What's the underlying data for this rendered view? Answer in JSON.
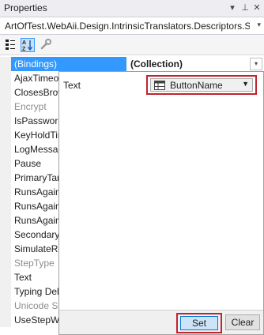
{
  "window": {
    "title": "Properties",
    "pin_glyph": "▾",
    "autohide_glyph": "⊥",
    "close_glyph": "✕"
  },
  "object_selector": {
    "value": "ArtOfTest.WebAii.Design.IntrinsicTranslators.Descriptors.Se",
    "arrow": "▾"
  },
  "toolbar": {
    "tools": [
      {
        "name": "categorized-icon",
        "active": false
      },
      {
        "name": "alphabetical-icon",
        "active": true
      },
      {
        "name": "wrench-icon",
        "active": false
      }
    ]
  },
  "grid": {
    "selected": {
      "name": "(Bindings)",
      "value": "(Collection)",
      "dropdown": "▾"
    },
    "rows": [
      {
        "name": "AjaxTimeout",
        "disabled": false
      },
      {
        "name": "ClosesBrowser",
        "disabled": false
      },
      {
        "name": "Encrypt",
        "disabled": true
      },
      {
        "name": "IsPassword",
        "disabled": false
      },
      {
        "name": "KeyHoldTime",
        "disabled": false
      },
      {
        "name": "LogMessage",
        "disabled": false
      },
      {
        "name": "Pause",
        "disabled": false
      },
      {
        "name": "PrimaryTarget",
        "disabled": false
      },
      {
        "name": "RunsAgainst",
        "disabled": false
      },
      {
        "name": "RunsAgainst",
        "disabled": false
      },
      {
        "name": "RunsAgainst",
        "disabled": false
      },
      {
        "name": "SecondaryTarget",
        "disabled": false
      },
      {
        "name": "SimulateRealTyping",
        "disabled": false
      },
      {
        "name": "StepType",
        "disabled": true
      },
      {
        "name": "Text",
        "disabled": false
      },
      {
        "name": "Typing Delay",
        "disabled": false
      },
      {
        "name": "Unicode String",
        "disabled": true
      },
      {
        "name": "UseStepWait",
        "disabled": false
      }
    ]
  },
  "binding_popup": {
    "property_label": "Text",
    "variable_value": "ButtonName",
    "dropdown_arrow": "▼",
    "set_label": "Set",
    "clear_label": "Clear"
  }
}
